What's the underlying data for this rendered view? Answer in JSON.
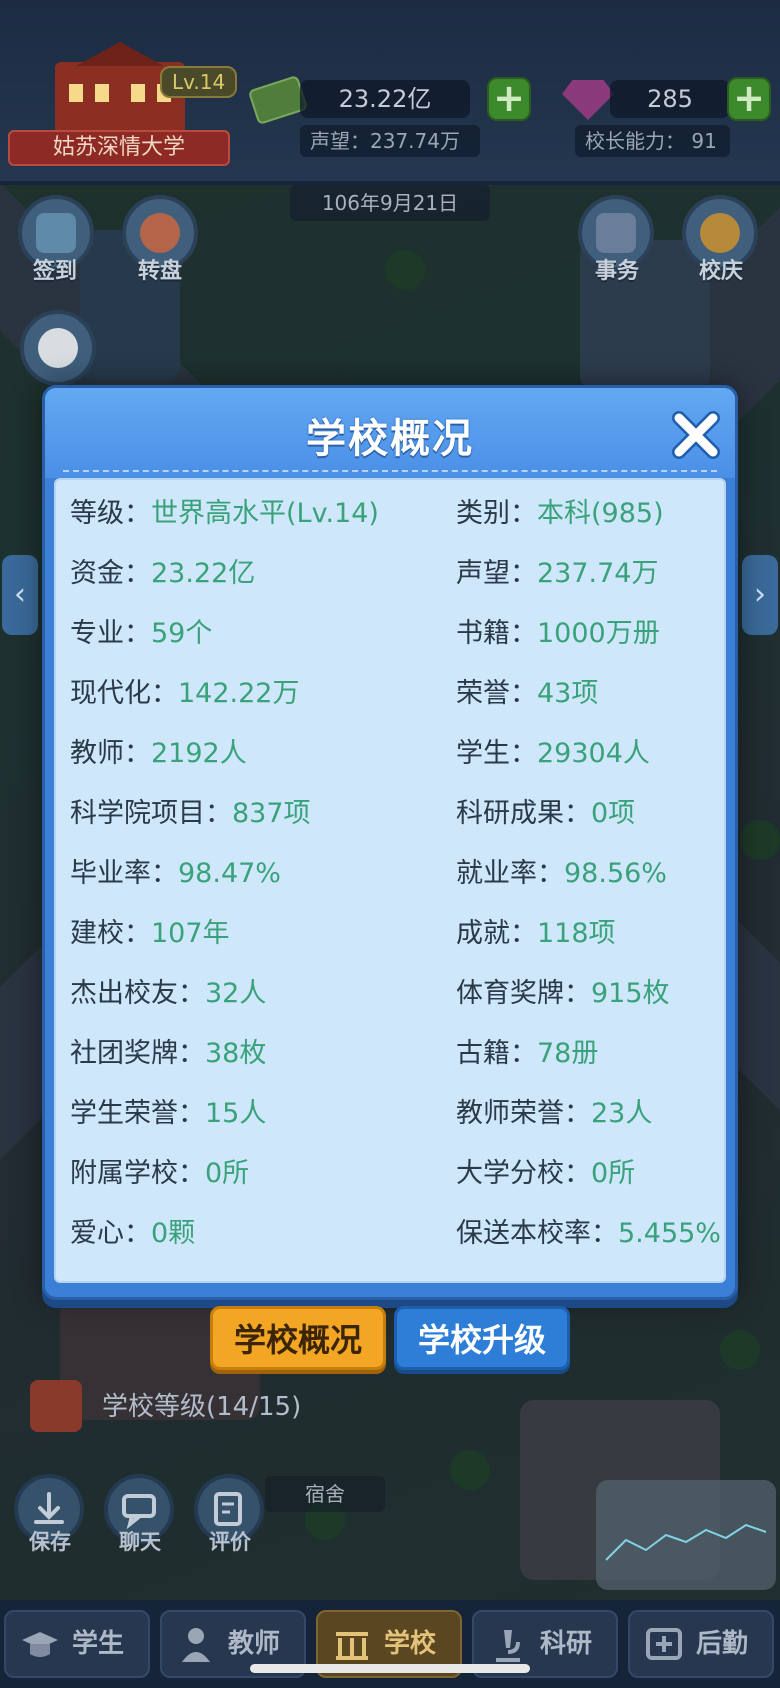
{
  "header": {
    "school_name": "姑苏深情大学",
    "level_badge": "Lv.14",
    "funds": "23.22亿",
    "prestige": "声望：237.74万",
    "gems": "285",
    "principal_ability": "校长能力：  91",
    "date": "106年9月21日"
  },
  "side_buttons": {
    "checkin": "签到",
    "wheel": "转盘",
    "affairs": "事务",
    "anniversary": "校庆"
  },
  "modal": {
    "title": "学校概况",
    "rows": [
      {
        "l_label": "等级：",
        "l_value": "世界高水平(Lv.14)",
        "r_label": "类别：",
        "r_value": "本科(985)"
      },
      {
        "l_label": "资金：",
        "l_value": "23.22亿",
        "r_label": "声望：",
        "r_value": "237.74万"
      },
      {
        "l_label": "专业：",
        "l_value": "59个",
        "r_label": "书籍：",
        "r_value": "1000万册"
      },
      {
        "l_label": "现代化：",
        "l_value": "142.22万",
        "r_label": "荣誉：",
        "r_value": "43项"
      },
      {
        "l_label": "教师：",
        "l_value": "2192人",
        "r_label": "学生：",
        "r_value": "29304人"
      },
      {
        "l_label": "科学院项目：",
        "l_value": "837项",
        "r_label": "科研成果：",
        "r_value": "0项"
      },
      {
        "l_label": "毕业率：",
        "l_value": "98.47%",
        "r_label": "就业率：",
        "r_value": "98.56%"
      },
      {
        "l_label": "建校：",
        "l_value": "107年",
        "r_label": "成就：",
        "r_value": "118项"
      },
      {
        "l_label": "杰出校友：",
        "l_value": "32人",
        "r_label": "体育奖牌：",
        "r_value": "915枚"
      },
      {
        "l_label": "社团奖牌：",
        "l_value": "38枚",
        "r_label": "古籍：",
        "r_value": "78册"
      },
      {
        "l_label": "学生荣誉：",
        "l_value": "15人",
        "r_label": "教师荣誉：",
        "r_value": "23人"
      },
      {
        "l_label": "附属学校：",
        "l_value": "0所",
        "r_label": "大学分校：",
        "r_value": "0所"
      },
      {
        "l_label": "爱心：",
        "l_value": "0颗",
        "r_label": "保送本校率：",
        "r_value": "5.455%"
      }
    ]
  },
  "tabs": {
    "overview": "学校概况",
    "upgrade": "学校升级"
  },
  "school_level": "学校等级(14/15)",
  "dorm_label": "宿舍",
  "mini_buttons": {
    "save": "保存",
    "chat": "聊天",
    "review": "评价"
  },
  "nav": {
    "students": "学生",
    "teachers": "教师",
    "school": "学校",
    "research": "科研",
    "logistics": "后勤"
  },
  "colors": {
    "modal_blue": "#3b7fd6",
    "panel_bg": "#cfe7fb",
    "value_green": "#3aa27a",
    "tab_active": "#f2a623",
    "tab_inactive": "#2e7ed8"
  }
}
